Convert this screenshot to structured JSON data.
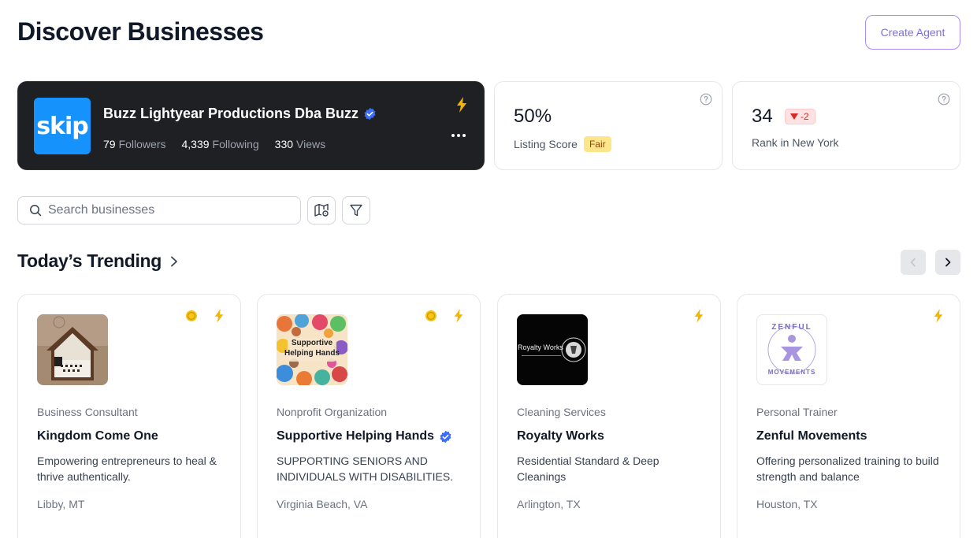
{
  "page": {
    "title": "Discover Businesses"
  },
  "header": {
    "create_agent_label": "Create Agent"
  },
  "profile": {
    "logo_text": "skip",
    "name": "Buzz Lightyear Productions Dba Buzz",
    "verified": true,
    "followers_count": "79",
    "followers_label": "Followers",
    "following_count": "4,339",
    "following_label": "Following",
    "views_count": "330",
    "views_label": "Views"
  },
  "listing_score": {
    "value": "50%",
    "label": "Listing Score",
    "badge": "Fair"
  },
  "rank": {
    "value": "34",
    "change": "-2",
    "label": "Rank in New York"
  },
  "search": {
    "placeholder": "Search businesses",
    "value": ""
  },
  "trending": {
    "title": "Today’s Trending",
    "cards": [
      {
        "category": "Business Consultant",
        "name": "Kingdom Come One",
        "verified": false,
        "description": "Empowering entrepreneurs to heal & thrive authentically.",
        "location": "Libby, MT",
        "icons": [
          "coin-icon",
          "bolt-icon"
        ]
      },
      {
        "category": "Nonprofit Organization",
        "name": "Supportive Helping Hands",
        "verified": true,
        "description": "SUPPORTING SENIORS AND INDIVIDUALS WITH DISABILITIES.",
        "location": "Virginia Beach, VA",
        "image_text_1": "Supportive",
        "image_text_2": "Helping Hands",
        "icons": [
          "coin-icon",
          "bolt-icon"
        ]
      },
      {
        "category": "Cleaning Services",
        "name": "Royalty Works",
        "verified": false,
        "description": "Residential Standard & Deep Cleanings",
        "location": "Arlington, TX",
        "image_text": "Royalty Works",
        "icons": [
          "bolt-icon"
        ]
      },
      {
        "category": "Personal Trainer",
        "name": "Zenful Movements",
        "verified": false,
        "description": "Offering personalized training to build strength and balance",
        "location": "Houston, TX",
        "image_text_top": "ZENFUL",
        "image_text_bottom": "MOVEMENTS",
        "icons": [
          "bolt-icon"
        ]
      }
    ]
  },
  "colors": {
    "accent": "#7c6cf0",
    "verified": "#3b6ef6",
    "bolt": "#f5b400",
    "coin": "#f5c518"
  }
}
